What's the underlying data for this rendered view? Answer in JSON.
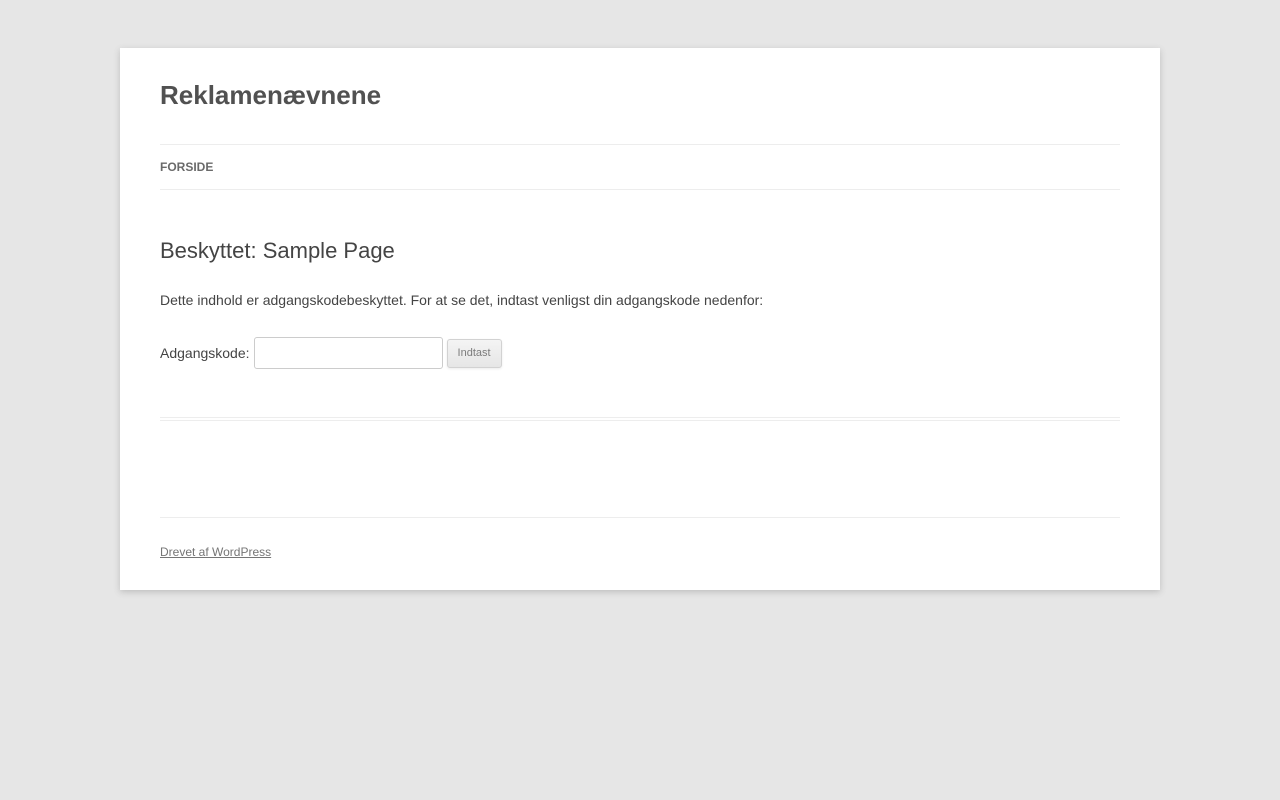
{
  "site": {
    "title": "Reklamenævnene"
  },
  "nav": {
    "items": [
      {
        "label": "FORSIDE"
      }
    ]
  },
  "entry": {
    "title": "Beskyttet: Sample Page",
    "notice": "Dette indhold er adgangskodebeskyttet. For at se det, indtast venligst din adgangskode nedenfor:",
    "password_label": "Adgangskode:",
    "password_value": "",
    "submit_label": "Indtast"
  },
  "footer": {
    "credit": "Drevet af WordPress"
  }
}
